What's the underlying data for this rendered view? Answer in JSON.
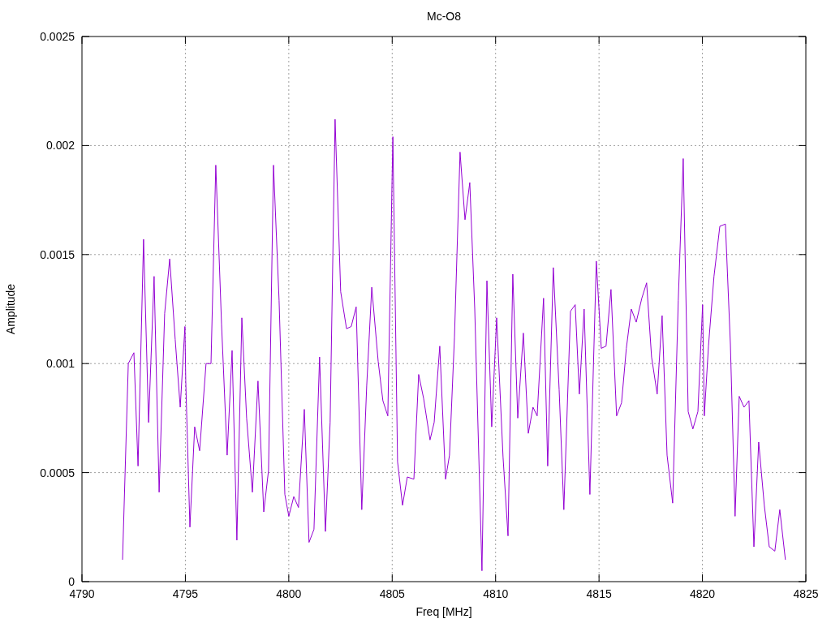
{
  "chart": {
    "chart_data": {
      "type": "line",
      "title": "Mc-O8",
      "xlabel": "Freq [MHz]",
      "ylabel": "Amplitude",
      "grid": true,
      "xlim": [
        4790,
        4825
      ],
      "ylim": [
        0,
        0.0025
      ],
      "xticks": [
        4790,
        4795,
        4800,
        4805,
        4810,
        4815,
        4820,
        4825
      ],
      "yticks": [
        {
          "value": 0,
          "label": "0"
        },
        {
          "value": 0.0005,
          "label": "0.0005"
        },
        {
          "value": 0.001,
          "label": "0.001"
        },
        {
          "value": 0.0015,
          "label": "0.0015"
        },
        {
          "value": 0.002,
          "label": "0.002"
        },
        {
          "value": 0.0025,
          "label": "0.0025"
        }
      ],
      "x": [
        4791.96,
        4792.24,
        4792.51,
        4792.71,
        4792.98,
        4793.22,
        4793.49,
        4793.73,
        4794.0,
        4794.24,
        4794.51,
        4794.75,
        4794.98,
        4795.02,
        4795.22,
        4795.45,
        4795.69,
        4796.0,
        4796.24,
        4796.47,
        4796.75,
        4797.02,
        4797.26,
        4797.49,
        4797.73,
        4797.96,
        4798.24,
        4798.51,
        4798.79,
        4799.02,
        4799.26,
        4799.53,
        4799.81,
        4800.0,
        4800.24,
        4800.47,
        4800.75,
        4800.98,
        4801.22,
        4801.49,
        4801.77,
        4802.0,
        4802.24,
        4802.51,
        4802.79,
        4803.02,
        4803.26,
        4803.53,
        4803.77,
        4804.01,
        4804.32,
        4804.55,
        4804.79,
        4805.03,
        4805.26,
        4805.5,
        4805.73,
        4806.05,
        4806.28,
        4806.52,
        4806.83,
        4807.03,
        4807.3,
        4807.58,
        4807.77,
        4808.01,
        4808.28,
        4808.52,
        4808.75,
        4808.99,
        4809.34,
        4809.58,
        4809.81,
        4810.05,
        4810.36,
        4810.6,
        4810.83,
        4811.07,
        4811.34,
        4811.58,
        4811.81,
        4812.01,
        4812.32,
        4812.52,
        4812.79,
        4813.07,
        4813.3,
        4813.62,
        4813.85,
        4814.05,
        4814.28,
        4814.56,
        4814.87,
        4815.11,
        4815.34,
        4815.58,
        4815.85,
        4816.09,
        4816.32,
        4816.56,
        4816.8,
        4817.07,
        4817.3,
        4817.54,
        4817.81,
        4818.05,
        4818.29,
        4818.56,
        4818.83,
        4819.07,
        4819.31,
        4819.54,
        4819.78,
        4820.01,
        4820.09,
        4820.29,
        4820.56,
        4820.84,
        4821.11,
        4821.35,
        4821.58,
        4821.78,
        4822.01,
        4822.25,
        4822.49,
        4822.72,
        4822.99,
        4823.23,
        4823.5,
        4823.74,
        4824.01
      ],
      "series": [
        {
          "color": "#9400d3",
          "values": [
            0.0001,
            0.001,
            0.00105,
            0.00053,
            0.00157,
            0.00073,
            0.0014,
            0.00041,
            0.00123,
            0.00148,
            0.00111,
            0.0008,
            0.00117,
            0.00092,
            0.00025,
            0.00071,
            0.0006,
            0.001,
            0.001,
            0.00191,
            0.00118,
            0.00058,
            0.00106,
            0.00019,
            0.00121,
            0.00075,
            0.00041,
            0.00092,
            0.00032,
            0.00051,
            0.00191,
            0.00129,
            0.0004,
            0.0003,
            0.00039,
            0.00034,
            0.00079,
            0.00018,
            0.00024,
            0.00103,
            0.00023,
            0.00073,
            0.00212,
            0.00133,
            0.00116,
            0.00117,
            0.00126,
            0.00033,
            0.0009,
            0.00135,
            0.00101,
            0.00083,
            0.00076,
            0.00204,
            0.00055,
            0.00035,
            0.00048,
            0.00047,
            0.00095,
            0.00084,
            0.00065,
            0.00073,
            0.00108,
            0.00047,
            0.00058,
            0.00112,
            0.00197,
            0.00166,
            0.00183,
            0.00125,
            5e-05,
            0.00138,
            0.00071,
            0.00121,
            0.00057,
            0.00021,
            0.00141,
            0.00075,
            0.00114,
            0.00068,
            0.0008,
            0.00076,
            0.0013,
            0.00053,
            0.00144,
            0.00088,
            0.00033,
            0.00124,
            0.00127,
            0.00086,
            0.00125,
            0.0004,
            0.00147,
            0.00107,
            0.00108,
            0.00134,
            0.00076,
            0.00082,
            0.00107,
            0.00125,
            0.00119,
            0.0013,
            0.00137,
            0.00103,
            0.00086,
            0.00122,
            0.00058,
            0.00036,
            0.00129,
            0.00194,
            0.00078,
            0.0007,
            0.00078,
            0.00127,
            0.00076,
            0.00108,
            0.0014,
            0.00163,
            0.00164,
            0.00109,
            0.0003,
            0.00085,
            0.0008,
            0.00083,
            0.00016,
            0.00064,
            0.00035,
            0.00016,
            0.00014,
            0.00033,
            0.0001
          ]
        }
      ]
    }
  }
}
